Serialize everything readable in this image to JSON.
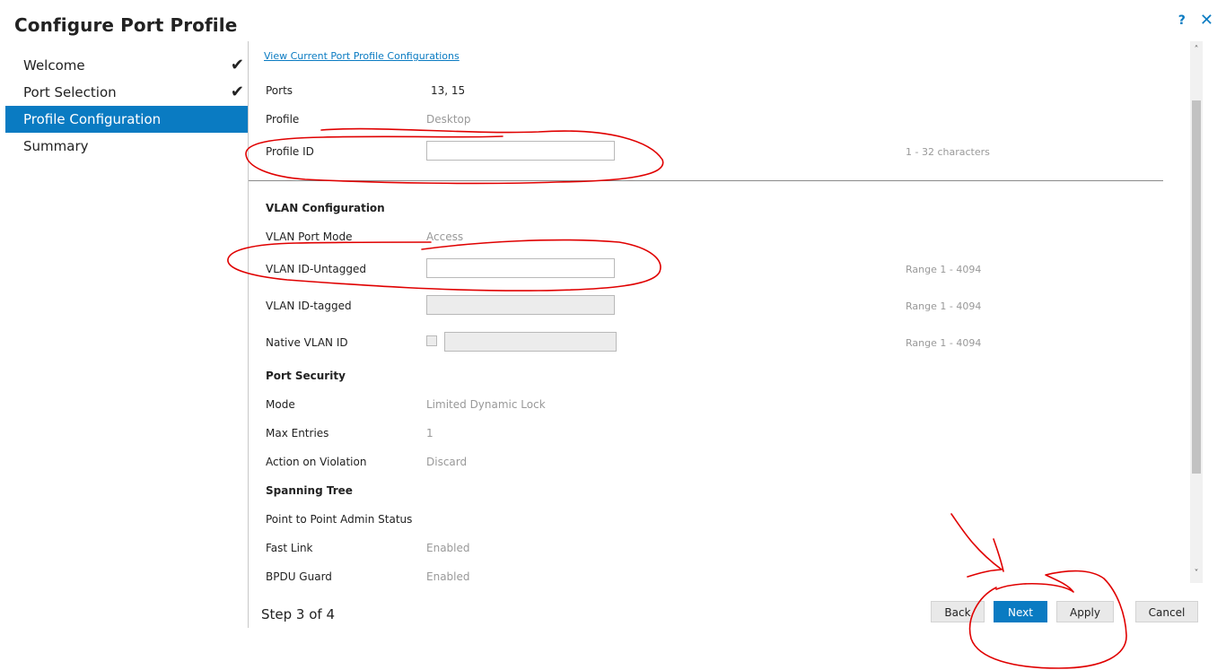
{
  "dialog": {
    "title": "Configure Port Profile",
    "help_icon": "?",
    "close_icon": "✕"
  },
  "sidebar": {
    "items": [
      {
        "label": "Welcome",
        "completed": true
      },
      {
        "label": "Port Selection",
        "completed": true
      },
      {
        "label": "Profile Configuration",
        "active": true
      },
      {
        "label": "Summary"
      }
    ],
    "check_glyph": "✔"
  },
  "content": {
    "view_link": "View Current Port Profile Configurations",
    "ports": {
      "label": "Ports",
      "value": "13, 15"
    },
    "profile": {
      "label": "Profile",
      "value": "Desktop"
    },
    "profile_id": {
      "label": "Profile ID",
      "value": "",
      "hint": "1 - 32 characters"
    },
    "vlan_configuration": {
      "heading": "VLAN Configuration"
    },
    "vlan_port_mode": {
      "label": "VLAN Port Mode",
      "value": "Access"
    },
    "vlan_id_untagged": {
      "label": "VLAN ID-Untagged",
      "value": "",
      "hint": "Range 1 - 4094"
    },
    "vlan_id_tagged": {
      "label": "VLAN ID-tagged",
      "value": "",
      "hint": "Range 1 - 4094"
    },
    "native_vlan_id": {
      "label": "Native VLAN ID",
      "checked": false,
      "value": "",
      "hint": "Range 1 - 4094"
    },
    "port_security": {
      "heading": "Port Security"
    },
    "mode": {
      "label": "Mode",
      "value": "Limited Dynamic Lock"
    },
    "max_entries": {
      "label": "Max Entries",
      "value": "1"
    },
    "action_on_violation": {
      "label": "Action on Violation",
      "value": "Discard"
    },
    "spanning_tree": {
      "heading": "Spanning Tree"
    },
    "point_to_point": {
      "label": "Point to Point Admin Status",
      "value": ""
    },
    "fast_link": {
      "label": "Fast Link",
      "value": "Enabled"
    },
    "bpdu_guard": {
      "label": "BPDU Guard",
      "value": "Enabled"
    }
  },
  "scrollbar": {
    "up_glyph": "˄",
    "down_glyph": "˅"
  },
  "footer": {
    "step": "Step 3 of 4",
    "back": "Back",
    "next": "Next",
    "apply": "Apply",
    "cancel": "Cancel"
  },
  "colors": {
    "accent": "#0a7bc2",
    "annotation": "#e00000"
  }
}
